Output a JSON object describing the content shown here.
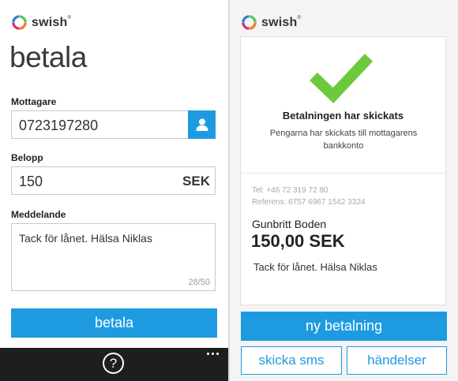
{
  "left_screen": {
    "logo_text": "swish",
    "logo_mark": "®",
    "title": "betala",
    "recipient": {
      "label": "Mottagare",
      "value": "0723197280",
      "icon": "person-icon"
    },
    "amount": {
      "label": "Belopp",
      "value": "150",
      "currency": "SEK"
    },
    "message": {
      "label": "Meddelande",
      "value": "Tack för lånet. Hälsa Niklas",
      "counter": "28/50"
    },
    "pay_button": "betala",
    "appbar": {
      "help_symbol": "?"
    }
  },
  "right_screen": {
    "logo_text": "swish",
    "logo_mark": "®",
    "success_title": "Betalningen har skickats",
    "success_message": "Pengarna har skickats till mottagarens bankkonto",
    "phone": "Tel: +46 72 319 72 80",
    "reference": "Referens: 6757 6967 1542 3324",
    "recipient_name": "Gunbritt Boden",
    "amount": "150,00 SEK",
    "message": "Tack för lånet. Hälsa Niklas",
    "new_payment_button": "ny betalning",
    "sms_button": "skicka sms",
    "events_button": "händelser"
  },
  "colors": {
    "accent": "#1e9be0",
    "check": "#6cc93b",
    "appbar": "#1e1e1e"
  }
}
